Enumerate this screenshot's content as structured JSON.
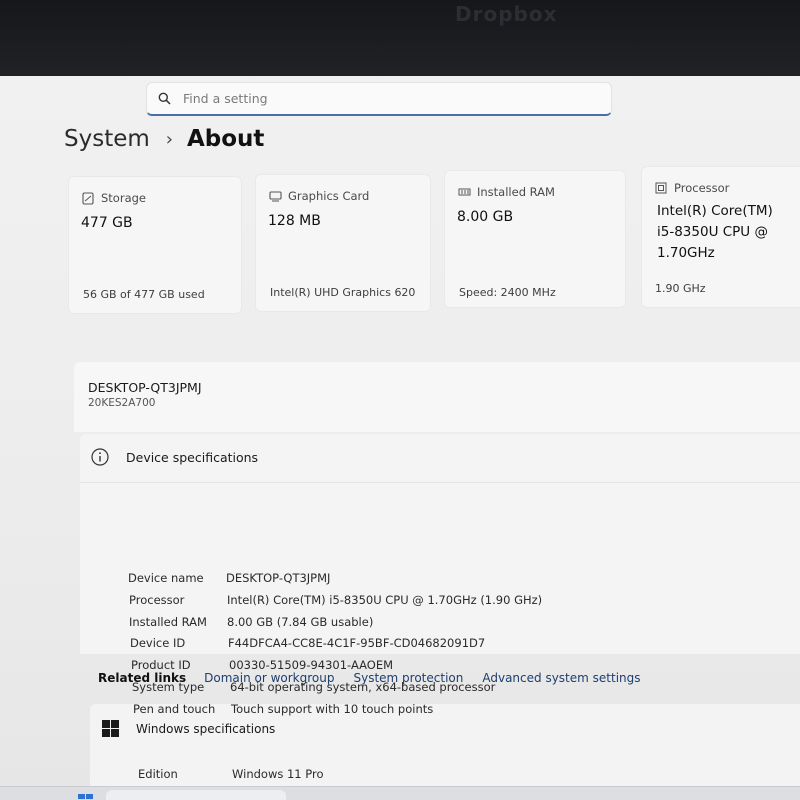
{
  "background": {
    "app_title": "Dropbox"
  },
  "search": {
    "placeholder": "Find a setting"
  },
  "breadcrumb": {
    "parent": "System",
    "separator": "›",
    "current": "About"
  },
  "cards": [
    {
      "icon": "storage-icon",
      "title": "Storage",
      "value": "477 GB",
      "detail": "56 GB of 477 GB used"
    },
    {
      "icon": "graphics-card-icon",
      "title": "Graphics Card",
      "value": "128 MB",
      "detail": "Intel(R) UHD Graphics 620"
    },
    {
      "icon": "ram-icon",
      "title": "Installed RAM",
      "value": "8.00 GB",
      "detail": "Speed: 2400 MHz"
    },
    {
      "icon": "processor-icon",
      "title": "Processor",
      "value_lines": [
        "Intel(R) Core(TM)",
        "i5-8350U CPU @",
        "1.70GHz"
      ],
      "detail": "1.90 GHz"
    }
  ],
  "device": {
    "name": "DESKTOP-QT3JPMJ",
    "model": "20KES2A700"
  },
  "device_specs": {
    "title": "Device specifications",
    "rows": [
      {
        "label": "Device name",
        "value": "DESKTOP-QT3JPMJ"
      },
      {
        "label": "Processor",
        "value": "Intel(R) Core(TM) i5-8350U CPU @ 1.70GHz (1.90 GHz)"
      },
      {
        "label": "Installed RAM",
        "value": "8.00 GB (7.84 GB usable)"
      },
      {
        "label": "Device ID",
        "value": "F44DFCA4-CC8E-4C1F-95BF-CD04682091D7"
      },
      {
        "label": "Product ID",
        "value": "00330-51509-94301-AAOEM"
      },
      {
        "label": "System type",
        "value": "64-bit operating system, x64-based processor"
      },
      {
        "label": "Pen and touch",
        "value": "Touch support with 10 touch points"
      }
    ]
  },
  "related_links": {
    "title": "Related links",
    "links": [
      "Domain or workgroup",
      "System protection",
      "Advanced system settings"
    ]
  },
  "windows_specs": {
    "title": "Windows specifications",
    "rows": [
      {
        "label": "Edition",
        "value": "Windows 11 Pro"
      }
    ]
  },
  "colors": {
    "accent": "#4a6fa5",
    "link": "#1d3e6e",
    "window_bg": "#ececec"
  }
}
